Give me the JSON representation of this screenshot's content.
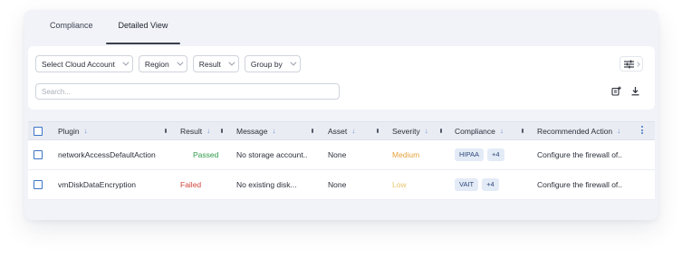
{
  "tabs": [
    {
      "label": "Compliance",
      "active": false
    },
    {
      "label": "Detailed View",
      "active": true
    }
  ],
  "filters": {
    "cloud_account": "Select Cloud Account",
    "region": "Region",
    "result": "Result",
    "group_by": "Group by"
  },
  "search": {
    "placeholder": "Search..."
  },
  "table": {
    "columns": [
      "Plugin",
      "Result",
      "Message",
      "Asset",
      "Severity",
      "Compliance",
      "Recommended Action"
    ],
    "sort_icon": "↓",
    "rows": [
      {
        "plugin": "networkAccessDefaultAction",
        "result": "Passed",
        "message": "No storage account..",
        "asset": "None",
        "severity": "Medium",
        "compliance_tag": "HIPAA",
        "compliance_more": "+4",
        "action": "Configure the firewall of.."
      },
      {
        "plugin": "vmDiskDataEncryption",
        "result": "Failed",
        "message": "No existing disk...",
        "asset": "None",
        "severity": "Low",
        "compliance_tag": "VAIT",
        "compliance_more": "+4",
        "action": "Configure the firewall of.."
      }
    ]
  },
  "colors": {
    "passed": "#2f9a46",
    "failed": "#d0433a",
    "medium": "#e3a13b",
    "low": "#e9c46a",
    "accent": "#3d74c7"
  }
}
